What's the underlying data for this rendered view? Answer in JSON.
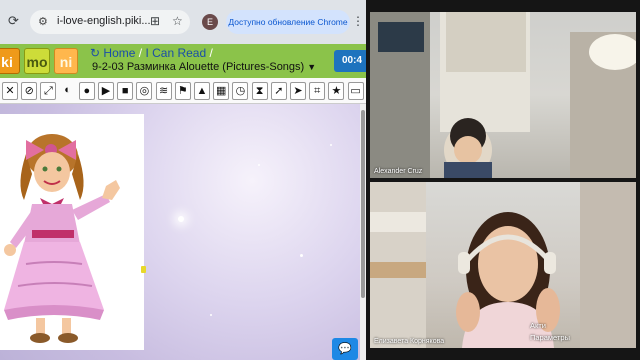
{
  "browser": {
    "url": "i-love-english.piki...",
    "update_label": "Доступно обновление Chrome",
    "avatar_letter": "E"
  },
  "site": {
    "tiles": [
      "ki",
      "mo",
      "ni"
    ],
    "breadcrumb": {
      "home": "Home",
      "sep1": "/",
      "section": "I Can Read",
      "sep2": "/"
    },
    "lesson_title": "9-2-03 Разминка Alouette (Pictures-Songs)",
    "lesson_arrow": "▼",
    "timer": "00:4"
  },
  "toolbar": {
    "icons": [
      {
        "name": "close-icon",
        "glyph": "✕"
      },
      {
        "name": "no-icon",
        "glyph": "⊘"
      },
      {
        "name": "resize-icon",
        "glyph": "⤢"
      },
      {
        "name": "contrast-icon",
        "glyph": "◐"
      },
      {
        "name": "record-icon",
        "glyph": "●"
      },
      {
        "name": "play-icon",
        "glyph": "▶"
      },
      {
        "name": "stop-icon",
        "glyph": "■"
      },
      {
        "name": "hide-icon",
        "glyph": "◎"
      },
      {
        "name": "rss-icon",
        "glyph": "≋"
      },
      {
        "name": "flag-icon",
        "glyph": "⚑"
      },
      {
        "name": "warning-icon",
        "glyph": "▲"
      },
      {
        "name": "calendar-icon",
        "glyph": "▦"
      },
      {
        "name": "clock-icon",
        "glyph": "◷"
      },
      {
        "name": "hourglass-icon",
        "glyph": "⧗"
      },
      {
        "name": "rocket-icon",
        "glyph": "➚"
      },
      {
        "name": "pointer-icon",
        "glyph": "➤"
      },
      {
        "name": "crop-icon",
        "glyph": "⌗"
      },
      {
        "name": "star-icon",
        "glyph": "★"
      },
      {
        "name": "screen-icon",
        "glyph": "▭"
      }
    ]
  },
  "video": {
    "participant1": "Alexander Cruz",
    "participant2": "Елизавета Корнякова",
    "subtitle_line1": "Акти",
    "subtitle_line2": "Параметры"
  },
  "colors": {
    "site_green": "#8bc34a",
    "accent_blue": "#1e73be",
    "update_pill": "#d3e3fd"
  }
}
